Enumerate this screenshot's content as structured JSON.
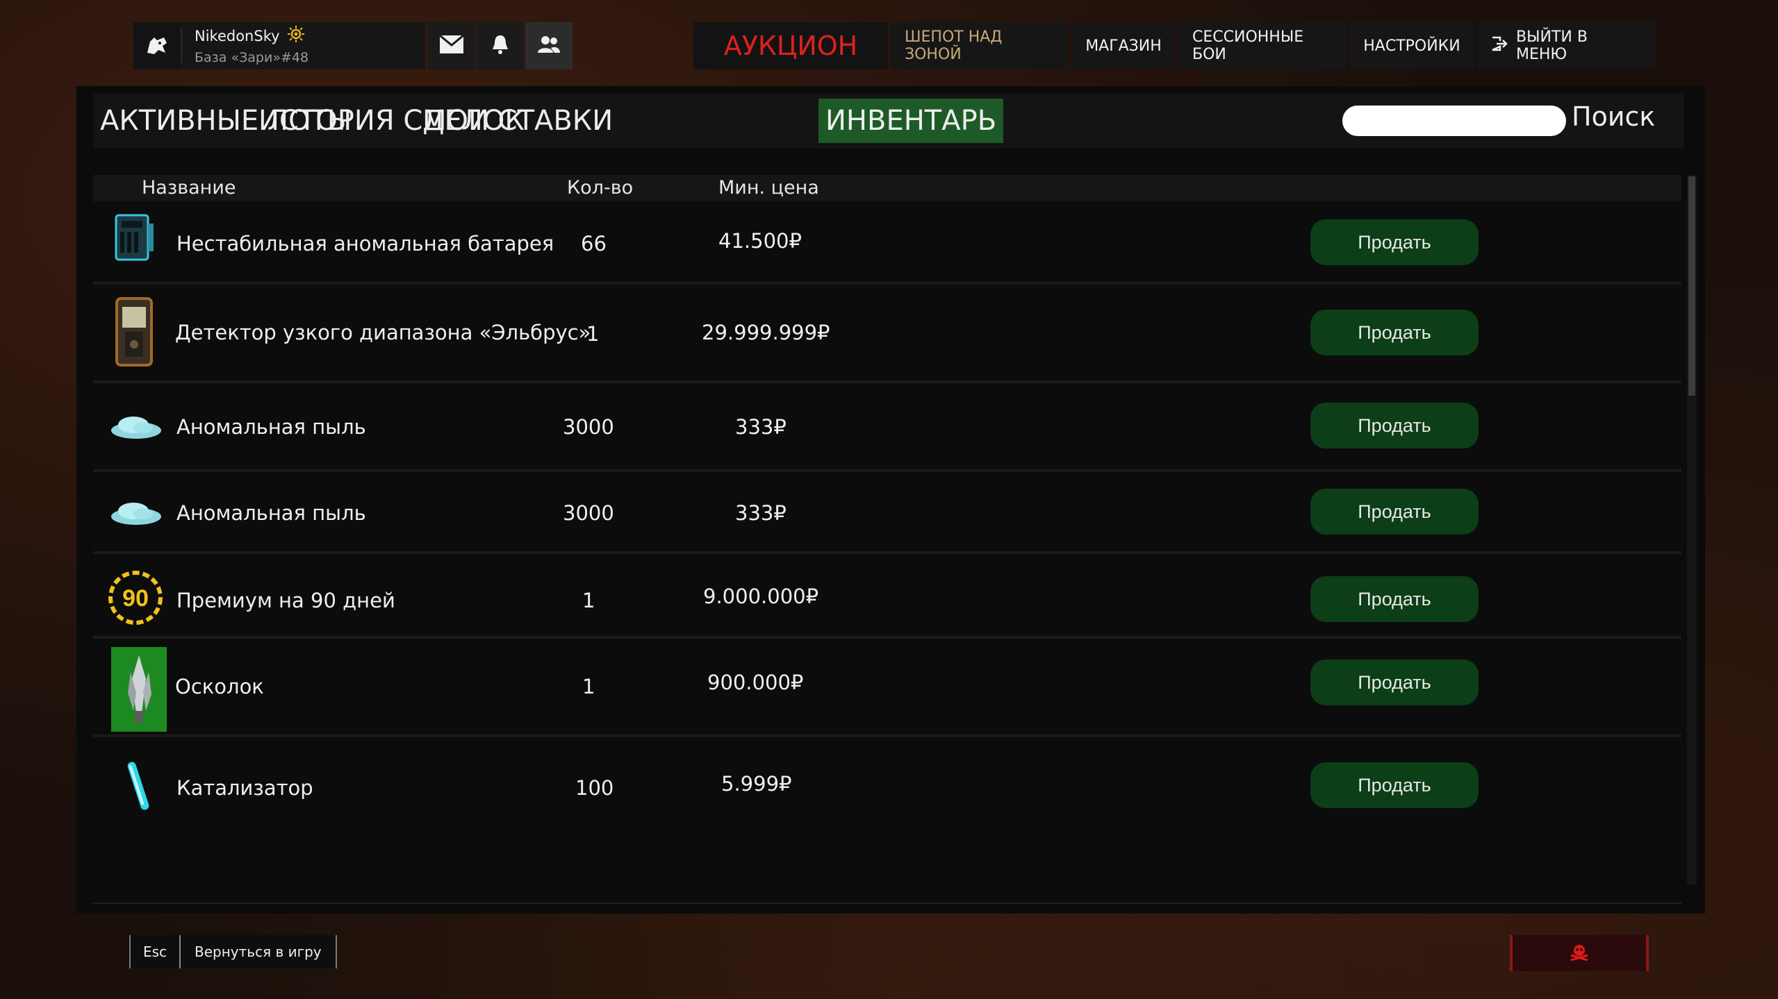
{
  "profile": {
    "username": "NikedonSky",
    "base": "База «Зари»#48",
    "avatar_icon": "wolf-head-icon",
    "badge_icon": "sun-badge-icon"
  },
  "top_icons": [
    "mail-icon",
    "bell-icon",
    "friends-icon"
  ],
  "nav": {
    "auction": "АУКЦИОН",
    "whisper": "ШЕПОТ НАД ЗОНОЙ",
    "shop": "МАГАЗИН",
    "sessions": "СЕССИОННЫЕ БОИ",
    "settings": "НАСТРОЙКИ",
    "exit": "ВЫЙТИ В МЕНЮ"
  },
  "tabs": {
    "active_lots": "АКТИВНЫЕ ЛОТЫ",
    "history": "ИСТОРИЯ СДЕЛОК",
    "my_bids": "МОИ СТАВКИ",
    "inventory": "ИНВЕНТАРЬ"
  },
  "search": {
    "placeholder": "",
    "label": "Поиск"
  },
  "table": {
    "col_name": "Название",
    "col_qty": "Кол-во",
    "col_price": "Мин. цена",
    "sell_label": "Продать",
    "rows": [
      {
        "name": "Нестабильная аномальная батарея",
        "qty": "66",
        "price": "41.500₽",
        "icon": "battery-icon"
      },
      {
        "name": "Детектор узкого диапазона «Эльбрус»",
        "qty": "1",
        "price": "29.999.999₽",
        "icon": "detector-icon"
      },
      {
        "name": "Аномальная пыль",
        "qty": "3000",
        "price": "333₽",
        "icon": "dust-icon"
      },
      {
        "name": "Аномальная пыль",
        "qty": "3000",
        "price": "333₽",
        "icon": "dust-icon"
      },
      {
        "name": "Премиум на 90 дней",
        "qty": "1",
        "price": "9.000.000₽",
        "icon": "premium-90-icon",
        "icon_text": "90"
      },
      {
        "name": "Осколок",
        "qty": "1",
        "price": "900.000₽",
        "icon": "shard-icon"
      },
      {
        "name": "Катализатор",
        "qty": "100",
        "price": "5.999₽",
        "icon": "catalyst-icon"
      }
    ]
  },
  "bottom": {
    "esc_key": "Esc",
    "return_label": "Вернуться в игру",
    "danger_icon": "skull-icon"
  },
  "colors": {
    "accent_green": "#1d5a27",
    "sell_button": "#0c3e17",
    "auction_red": "#e0201f",
    "whisper_tan": "#c9a978"
  }
}
